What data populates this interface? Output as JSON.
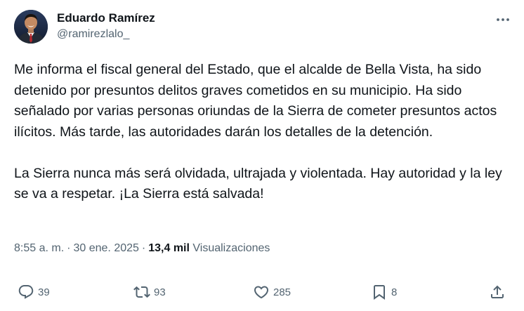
{
  "author": {
    "display_name": "Eduardo Ramírez",
    "handle": "@ramirezlalo_"
  },
  "tweet": {
    "paragraphs": [
      "Me informa el fiscal general del Estado, que el alcalde de Bella Vista, ha sido detenido por presuntos delitos graves cometidos en su municipio. Ha sido señalado por varias personas oriundas de la Sierra de cometer presuntos actos ilícitos. Más tarde, las autoridades darán los detalles de la detención.",
      "La Sierra nunca más será olvidada, ultrajada y violentada. Hay autoridad y la ley se va a respetar. ¡La Sierra está salvada!"
    ]
  },
  "meta": {
    "time": "8:55 a. m.",
    "separator": "·",
    "date": "30 ene. 2025",
    "views_count": "13,4 mil",
    "views_label": "Visualizaciones"
  },
  "actions": {
    "replies": "39",
    "reposts": "93",
    "likes": "285",
    "bookmarks": "8"
  },
  "icons": {
    "more": "more-icon",
    "reply": "reply-icon",
    "repost": "repost-icon",
    "like": "heart-icon",
    "bookmark": "bookmark-icon",
    "share": "share-icon"
  },
  "colors": {
    "text": "#0f1419",
    "secondary": "#536471"
  }
}
